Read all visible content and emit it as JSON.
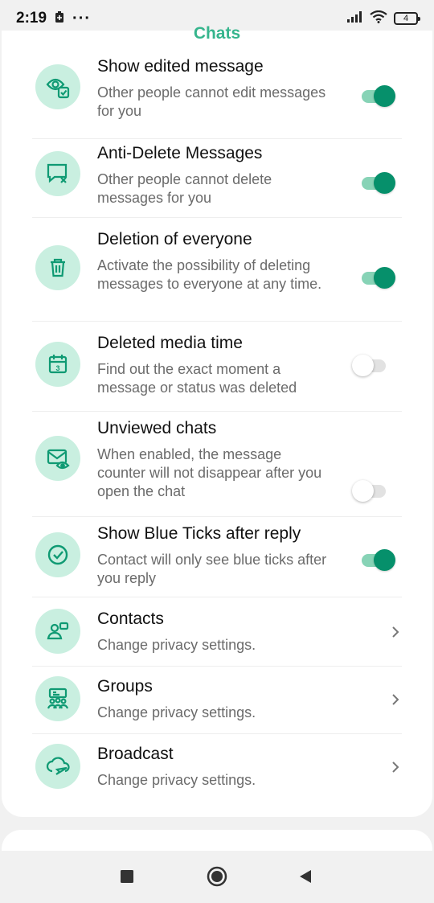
{
  "status_bar": {
    "time": "2:19",
    "dots": "···",
    "battery": "4"
  },
  "section": {
    "header": "Chats"
  },
  "settings": [
    {
      "title": "Show edited message",
      "subtitle": "Other people cannot edit messages for you",
      "control": "toggle",
      "on": true,
      "icon": "eye-edit-icon"
    },
    {
      "title": "Anti-Delete Messages",
      "subtitle": "Other people cannot delete messages for you",
      "control": "toggle",
      "on": true,
      "icon": "message-x-icon"
    },
    {
      "title": "Deletion of everyone",
      "subtitle": "Activate the possibility of deleting messages to everyone at any time.",
      "control": "toggle",
      "on": true,
      "icon": "trash-icon"
    },
    {
      "title": "Deleted media time",
      "subtitle": "Find out the exact moment a message or status was deleted",
      "control": "toggle",
      "on": false,
      "icon": "calendar-icon"
    },
    {
      "title": "Unviewed chats",
      "subtitle": "When enabled, the message counter will not disappear after you open the chat",
      "control": "toggle",
      "on": false,
      "icon": "mail-eye-icon"
    },
    {
      "title": "Show Blue Ticks after reply",
      "subtitle": "Contact will only see blue ticks after you reply",
      "control": "toggle",
      "on": true,
      "icon": "check-circle-icon"
    },
    {
      "title": "Contacts",
      "subtitle": "Change privacy settings.",
      "control": "chevron",
      "icon": "contacts-icon"
    },
    {
      "title": "Groups",
      "subtitle": "Change privacy settings.",
      "control": "chevron",
      "icon": "groups-icon"
    },
    {
      "title": "Broadcast",
      "subtitle": "Change privacy settings.",
      "control": "chevron",
      "icon": "broadcast-icon"
    }
  ],
  "colors": {
    "accent": "#06906b",
    "accent_light": "#87d3b6",
    "icon_bg": "#c9efe0",
    "icon_fg": "#0f9a73"
  }
}
